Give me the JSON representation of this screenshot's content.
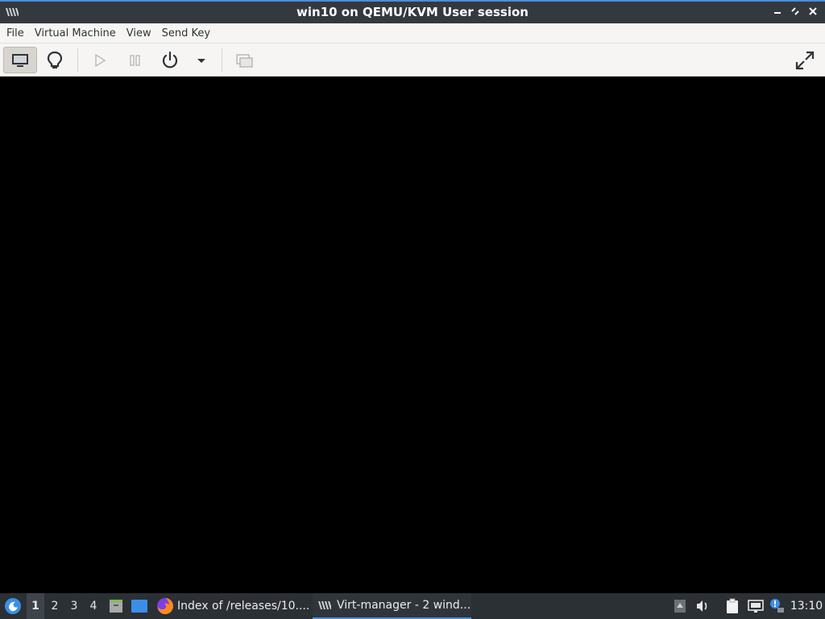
{
  "window": {
    "title": "win10 on QEMU/KVM User session",
    "app_icon": "virt-manager-icon",
    "controls": [
      "minimize-icon",
      "maximize-icon",
      "close-icon"
    ]
  },
  "menubar": {
    "items": [
      {
        "label": "File"
      },
      {
        "label": "Virtual Machine"
      },
      {
        "label": "View"
      },
      {
        "label": "Send Key"
      }
    ]
  },
  "toolbar": {
    "buttons": [
      {
        "icon": "monitor-icon",
        "state": "active"
      },
      {
        "icon": "lightbulb-icon",
        "state": "normal"
      },
      {
        "icon": "play-icon",
        "state": "disabled"
      },
      {
        "icon": "pause-icon",
        "state": "disabled"
      },
      {
        "icon": "power-icon",
        "state": "normal"
      },
      {
        "icon": "dropdown-arrow-icon",
        "state": "normal"
      },
      {
        "icon": "snapshots-icon",
        "state": "disabled"
      },
      {
        "icon": "fullscreen-icon",
        "state": "normal"
      }
    ]
  },
  "viewer": {
    "background": "#000000"
  },
  "taskbar": {
    "workspaces": [
      "1",
      "2",
      "3",
      "4"
    ],
    "active_workspace": "1",
    "tasks": [
      {
        "label": "Index of /releases/10....",
        "icon": "firefox-icon"
      },
      {
        "label": "Virt-manager - 2 wind...",
        "icon": "virt-manager-icon",
        "active": true
      }
    ],
    "clock": "13:10",
    "accent": "#4d8cd6"
  }
}
